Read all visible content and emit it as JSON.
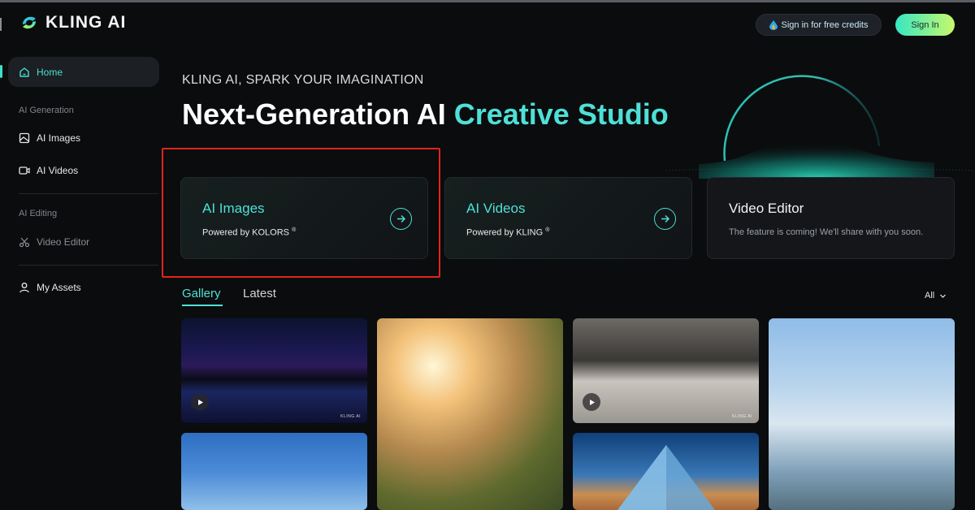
{
  "app": {
    "name": "KLING AI"
  },
  "header": {
    "credits_label": "Sign in for free credits",
    "signin_label": "Sign In"
  },
  "sidebar": {
    "home": "Home",
    "section_generation": "AI Generation",
    "ai_images": "AI Images",
    "ai_videos": "AI Videos",
    "section_editing": "AI Editing",
    "video_editor": "Video Editor",
    "my_assets": "My Assets"
  },
  "hero": {
    "tagline": "KLING AI, SPARK YOUR IMAGINATION",
    "headline_main": "Next-Generation AI ",
    "headline_accent": "Creative Studio"
  },
  "cards": [
    {
      "title": "AI Images",
      "subtitle": "Powered by KOLORS",
      "mark": "®"
    },
    {
      "title": "AI Videos",
      "subtitle": "Powered by KLING",
      "mark": "®"
    },
    {
      "title": "Video Editor",
      "subtitle": "The feature is coming! We'll share with you soon."
    }
  ],
  "gallery": {
    "tabs": [
      "Gallery",
      "Latest"
    ],
    "filter": "All",
    "watermark": "KLING AI"
  },
  "colors": {
    "accent": "#4ee0d6",
    "highlight": "#e3231e",
    "background": "#0b0c0e"
  }
}
